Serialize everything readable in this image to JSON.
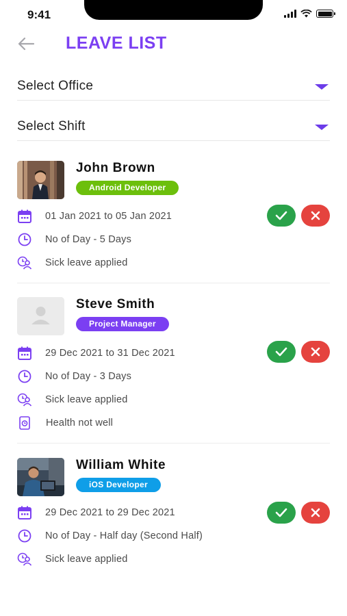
{
  "status_bar": {
    "time": "9:41"
  },
  "header": {
    "title": "LEAVE LIST",
    "back_icon": "arrow-left-icon"
  },
  "filters": {
    "office": {
      "label": "Select Office"
    },
    "shift": {
      "label": "Select Shift"
    }
  },
  "colors": {
    "accent": "#7b3ff2",
    "approve": "#2aa24a",
    "reject": "#e5433e",
    "badge_android": "#6cbf0c",
    "badge_pm": "#7b3ff2",
    "badge_ios": "#0f9ee8"
  },
  "leaves": [
    {
      "name": "John Brown",
      "role": "Android Developer",
      "date_range": "01 Jan 2021 to 05 Jan 2021",
      "days": "No of Day - 5 Days",
      "type": "Sick leave applied",
      "reason": ""
    },
    {
      "name": "Steve Smith",
      "role": "Project Manager",
      "date_range": "29 Dec 2021 to 31 Dec 2021",
      "days": "No of Day - 3 Days",
      "type": "Sick leave applied",
      "reason": "Health not well"
    },
    {
      "name": "William White",
      "role": "iOS Developer",
      "date_range": "29 Dec 2021 to 29 Dec 2021",
      "days": "No of Day - Half day (Second Half)",
      "type": "Sick leave applied",
      "reason": ""
    }
  ]
}
